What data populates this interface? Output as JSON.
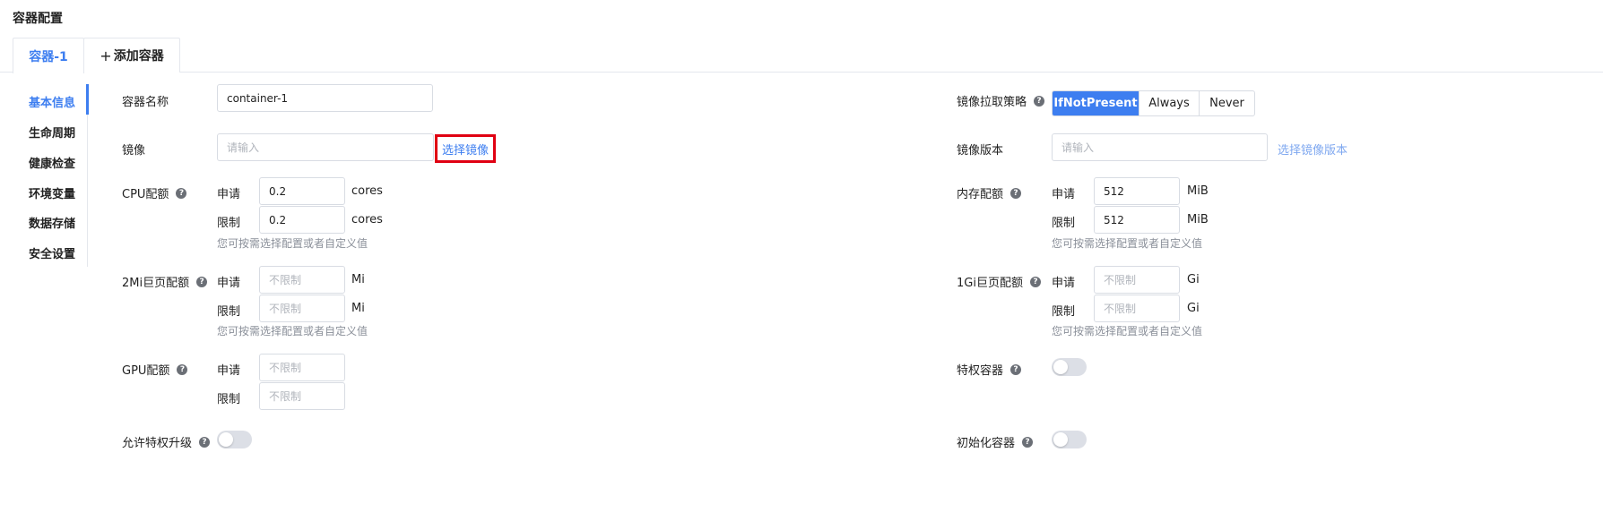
{
  "page": {
    "title": "容器配置"
  },
  "tabs": [
    {
      "label": "容器-1",
      "active": true
    },
    {
      "label": "添加容器",
      "icon": "plus-icon",
      "icon_glyph": "+"
    }
  ],
  "sidenav": {
    "items": [
      {
        "label": "基本信息",
        "active": true
      },
      {
        "label": "生命周期"
      },
      {
        "label": "健康检查"
      },
      {
        "label": "环境变量"
      },
      {
        "label": "数据存储"
      },
      {
        "label": "安全设置"
      }
    ]
  },
  "form": {
    "container_name": {
      "label": "容器名称",
      "value": "container-1"
    },
    "image": {
      "label": "镜像",
      "placeholder": "请输入",
      "select_link": "选择镜像"
    },
    "pull_policy": {
      "label": "镜像拉取策略",
      "help": "?",
      "options": [
        "IfNotPresent",
        "Always",
        "Never"
      ],
      "selected": "IfNotPresent"
    },
    "image_version": {
      "label": "镜像版本",
      "placeholder": "请输入",
      "select_link": "选择镜像版本"
    },
    "request_label": "申请",
    "limit_label": "限制",
    "hint": "您可按需选择配置或者自定义值",
    "cpu": {
      "label": "CPU配额",
      "help": "?",
      "request": "0.2",
      "limit": "0.2",
      "unit": "cores"
    },
    "memory": {
      "label": "内存配额",
      "help": "?",
      "request": "512",
      "limit": "512",
      "unit": "MiB"
    },
    "hugepage_2mi": {
      "label": "2Mi巨页配额",
      "help": "?",
      "placeholder": "不限制",
      "unit": "Mi"
    },
    "hugepage_1gi": {
      "label": "1Gi巨页配额",
      "help": "?",
      "placeholder": "不限制",
      "unit": "Gi"
    },
    "gpu": {
      "label": "GPU配额",
      "help": "?",
      "placeholder": "不限制"
    },
    "privileged": {
      "label": "特权容器",
      "help": "?",
      "enabled": false
    },
    "allow_privilege_escalation": {
      "label": "允许特权升级",
      "help": "?",
      "enabled": false
    },
    "init_container": {
      "label": "初始化容器",
      "help": "?",
      "enabled": false
    }
  },
  "colors": {
    "accent": "#3d7ef0",
    "highlight": "#e00012"
  }
}
